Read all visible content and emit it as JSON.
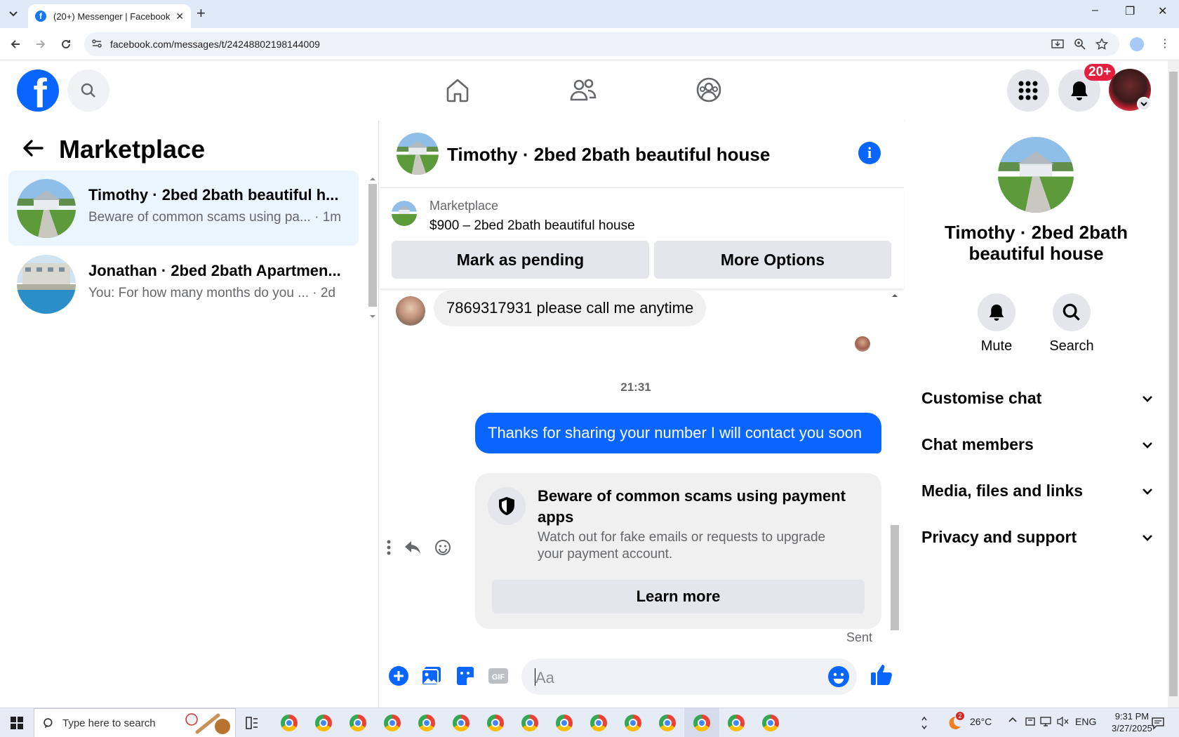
{
  "browser": {
    "tab_title": "(20+) Messenger | Facebook",
    "new_tab": "+",
    "url": "facebook.com/messages/t/24248802198144009",
    "window_controls": [
      "–",
      "❐",
      "✕"
    ]
  },
  "fb_header": {
    "logo": "f",
    "notification_badge": "20+",
    "nav_icons": [
      "home-icon",
      "friends-icon",
      "groups-icon"
    ],
    "accent": "#0866ff"
  },
  "sidebar": {
    "title": "Marketplace",
    "conversations": [
      {
        "name": "Timothy · 2bed 2bath beautiful h...",
        "preview": "Beware of common scams using pa... · 1m",
        "active": true
      },
      {
        "name": "Jonathan · 2bed 2bath Apartmen...",
        "preview": "You: For how many months do you ... · 2d",
        "active": false
      }
    ]
  },
  "chat": {
    "title": "Timothy · 2bed 2bath beautiful house",
    "listing": {
      "source": "Marketplace",
      "price_title": "$900 – 2bed 2bath beautiful house",
      "mark_pending": "Mark as pending",
      "more_options": "More Options"
    },
    "messages": {
      "incoming": "7869317931 please call me anytime",
      "timestamp": "21:31",
      "outgoing": "Thanks for sharing your number I will contact you soon",
      "status": "Sent"
    },
    "scam_card": {
      "heading": "Beware of common scams using payment apps",
      "body": "Watch out for fake emails or requests to upgrade your payment account.",
      "button": "Learn more"
    },
    "composer": {
      "placeholder": "Aa"
    }
  },
  "right_panel": {
    "title": "Timothy · 2bed 2bath beautiful house",
    "actions": [
      "Mute",
      "Search"
    ],
    "sections": [
      "Customise chat",
      "Chat members",
      "Media, files and links",
      "Privacy and support"
    ]
  },
  "taskbar": {
    "search_placeholder": "Type here to search",
    "weather_badge": "2",
    "temperature": "26°C",
    "language": "ENG",
    "time": "9:31 PM",
    "date": "3/27/2025"
  }
}
